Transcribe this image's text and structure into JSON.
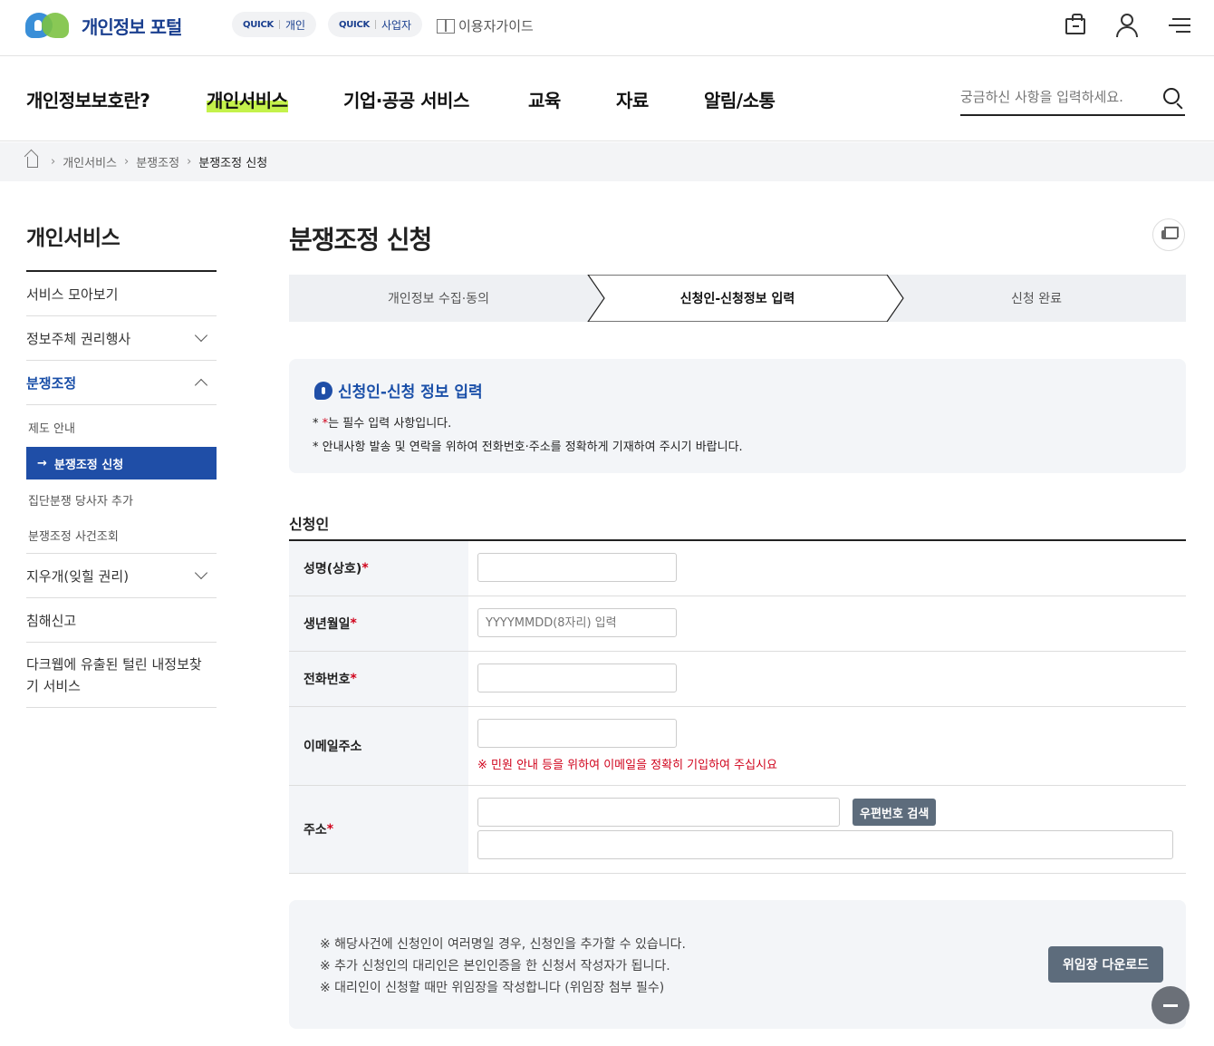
{
  "header": {
    "logo_text": "개인정보 포털",
    "quick1": {
      "tag": "QUICK",
      "label": "개인"
    },
    "quick2": {
      "tag": "QUICK",
      "label": "사업자"
    },
    "guide": "이용자가이드",
    "icons": [
      "briefcase-icon",
      "user-icon",
      "menu-icon"
    ]
  },
  "gnb": {
    "items": [
      "개인정보보호란?",
      "개인서비스",
      "기업·공공 서비스",
      "교육",
      "자료",
      "알림/소통"
    ],
    "active": "개인서비스",
    "search_placeholder": "궁금하신 사항을 입력하세요."
  },
  "breadcrumb": [
    "개인서비스",
    "분쟁조정",
    "분쟁조정 신청"
  ],
  "sidebar": {
    "title": "개인서비스",
    "items": [
      {
        "label": "서비스 모아보기"
      },
      {
        "label": "정보주체 권리행사"
      },
      {
        "label": "분쟁조정"
      },
      {
        "label": "지우개(잊힐 권리)"
      },
      {
        "label": "침해신고"
      },
      {
        "label": "다크웹에 유출된 털린 내정보찾기 서비스"
      }
    ],
    "sub": [
      {
        "label": "제도 안내"
      },
      {
        "label": "분쟁조정 신청"
      },
      {
        "label": "집단분쟁 당사자 추가"
      },
      {
        "label": "분쟁조정 사건조회"
      }
    ]
  },
  "main": {
    "title": "분쟁조정 신청",
    "steps": [
      "개인정보 수집·동의",
      "신청인-신청정보 입력",
      "신청 완료"
    ],
    "notice": {
      "title": "신청인-신청 정보 입력",
      "line1_rest": "는 필수 입력 사항입니다.",
      "line2": "* 안내사항 발송 및 연락을 위하여 전화번호·주소를 정확하게 기재하여 주시기 바랍니다."
    },
    "section_title": "신청인",
    "form": {
      "name_label": "성명(상호)",
      "birth_label": "생년월일",
      "birth_placeholder": "YYYYMMDD(8자리) 입력",
      "phone_label": "전화번호",
      "email_label": "이메일주소",
      "email_warning": "※ 민원 안내 등을 위하여 이메일을 정확히 기입하여 주십시요",
      "address_label": "주소",
      "zip_button": "우편번호 검색"
    },
    "bottom": {
      "lines": [
        "※ 해당사건에 신청인이 여러명일 경우, 신청인을 추가할 수 있습니다.",
        "※ 추가 신청인의 대리인은 본인인증을 한 신청서 작성자가 됩니다.",
        "※ 대리인이 신청할 때만 위임장을 작성합니다 (위임장 첨부 필수)"
      ],
      "download_button": "위임장 다운로드"
    }
  }
}
